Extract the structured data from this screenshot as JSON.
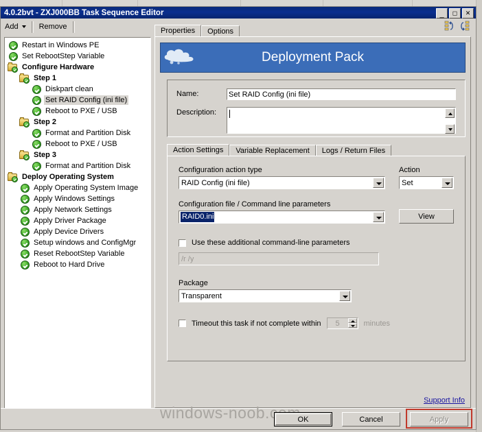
{
  "window": {
    "title": "4.0.2bvt - ZXJ000BB Task Sequence Editor",
    "controls": {
      "minimize": "_",
      "maximize": "❐",
      "close": "✕"
    }
  },
  "toolbar": {
    "add_label": "Add",
    "remove_label": "Remove",
    "icons": [
      "reorder-up-icon",
      "reorder-down-icon"
    ]
  },
  "background_strip": {
    "cells": [
      "",
      "",
      "",
      "",
      "",
      ""
    ]
  },
  "tree": {
    "items": [
      {
        "label": "Restart in Windows PE",
        "indent": 0,
        "icon": "green-check-icon",
        "group": false,
        "selected": false
      },
      {
        "label": "Set RebootStep Variable",
        "indent": 0,
        "icon": "green-check-icon",
        "group": false,
        "selected": false
      },
      {
        "label": "Configure Hardware",
        "indent": 0,
        "icon": "folder-check-icon",
        "group": true,
        "selected": false
      },
      {
        "label": "Step 1",
        "indent": 1,
        "icon": "folder-check-icon",
        "group": true,
        "selected": false
      },
      {
        "label": "Diskpart clean",
        "indent": 2,
        "icon": "green-check-icon",
        "group": false,
        "selected": false
      },
      {
        "label": "Set RAID Config (ini file)",
        "indent": 2,
        "icon": "green-check-icon",
        "group": false,
        "selected": true
      },
      {
        "label": "Reboot to PXE / USB",
        "indent": 2,
        "icon": "green-check-icon",
        "group": false,
        "selected": false
      },
      {
        "label": "Step 2",
        "indent": 1,
        "icon": "folder-check-icon",
        "group": true,
        "selected": false
      },
      {
        "label": "Format and Partition Disk",
        "indent": 2,
        "icon": "green-check-icon",
        "group": false,
        "selected": false
      },
      {
        "label": "Reboot to PXE / USB",
        "indent": 2,
        "icon": "green-check-icon",
        "group": false,
        "selected": false
      },
      {
        "label": "Step 3",
        "indent": 1,
        "icon": "folder-check-icon",
        "group": true,
        "selected": false
      },
      {
        "label": "Format and Partition Disk",
        "indent": 2,
        "icon": "green-check-icon",
        "group": false,
        "selected": false
      },
      {
        "label": "Deploy Operating System",
        "indent": 0,
        "icon": "folder-check-icon",
        "group": true,
        "selected": false
      },
      {
        "label": "Apply Operating System Image",
        "indent": 1,
        "icon": "green-check-icon",
        "group": false,
        "selected": false
      },
      {
        "label": "Apply Windows Settings",
        "indent": 1,
        "icon": "green-check-icon",
        "group": false,
        "selected": false
      },
      {
        "label": "Apply Network Settings",
        "indent": 1,
        "icon": "green-check-icon",
        "group": false,
        "selected": false
      },
      {
        "label": "Apply Driver Package",
        "indent": 1,
        "icon": "green-check-icon",
        "group": false,
        "selected": false
      },
      {
        "label": "Apply Device Drivers",
        "indent": 1,
        "icon": "green-check-icon",
        "group": false,
        "selected": false
      },
      {
        "label": "Setup windows and ConfigMgr",
        "indent": 1,
        "icon": "green-check-icon",
        "group": false,
        "selected": false
      },
      {
        "label": "Reset RebootStep Variable",
        "indent": 1,
        "icon": "green-check-icon",
        "group": false,
        "selected": false
      },
      {
        "label": "Reboot to Hard Drive",
        "indent": 1,
        "icon": "green-check-icon",
        "group": false,
        "selected": false
      }
    ]
  },
  "outer_tabs": [
    {
      "label": "Properties",
      "active": true
    },
    {
      "label": "Options",
      "active": false
    }
  ],
  "banner": {
    "title": "Deployment Pack",
    "icon": "cloud-icon",
    "color": "#3b6db8"
  },
  "properties": {
    "name_label": "Name:",
    "name_value": "Set RAID Config (ini file)",
    "description_label": "Description:",
    "description_value": ""
  },
  "inner_tabs": [
    {
      "label": "Action Settings",
      "active": true
    },
    {
      "label": "Variable Replacement",
      "active": false
    },
    {
      "label": "Logs / Return Files",
      "active": false
    }
  ],
  "action_settings": {
    "config_action_type_label": "Configuration action type",
    "config_action_type_value": "RAID Config (ini file)",
    "action_label": "Action",
    "action_value": "Set",
    "config_file_label": "Configuration file / Command line parameters",
    "config_file_value": "RAID0.ini",
    "config_file_selected": true,
    "view_button_label": "View",
    "extra_params_checkbox_label": "Use these additional command-line parameters",
    "extra_params_checked": false,
    "extra_params_placeholder": "/r /y",
    "extra_params_value": "",
    "package_label": "Package",
    "package_value": "Transparent",
    "timeout_checkbox_label": "Timeout this task if not complete within",
    "timeout_checked": false,
    "timeout_value": "5",
    "timeout_units": "minutes"
  },
  "support_info_link": "Support Info",
  "buttons": {
    "ok": "OK",
    "cancel": "Cancel",
    "apply": "Apply",
    "apply_disabled": true,
    "apply_highlight_color": "#c0392b"
  },
  "watermark": "windows-noob.com"
}
